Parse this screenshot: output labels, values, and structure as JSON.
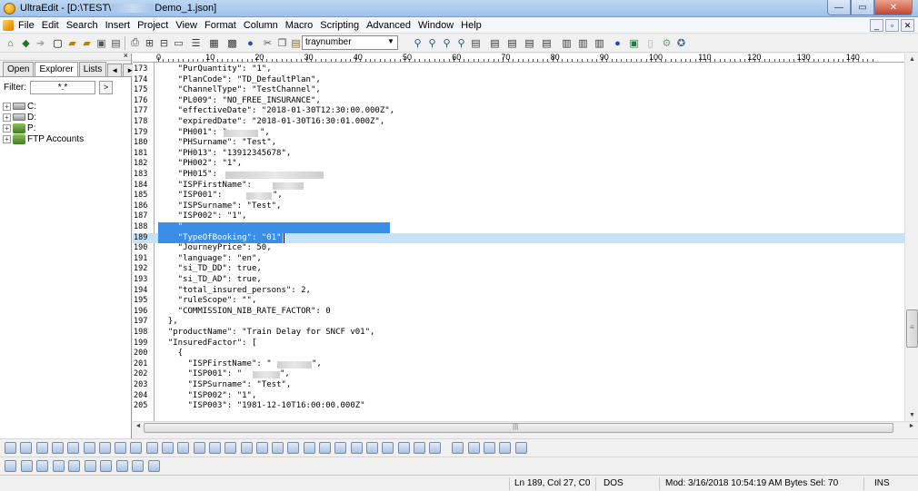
{
  "window": {
    "title_prefix": "UltraEdit - [D:\\TEST\\",
    "title_suffix": "Demo_1.json]",
    "buttons": {
      "minimize": "—",
      "maximize": "▭",
      "close": "✕"
    }
  },
  "menu": {
    "items": [
      "File",
      "Edit",
      "Search",
      "Insert",
      "Project",
      "View",
      "Format",
      "Column",
      "Macro",
      "Scripting",
      "Advanced",
      "Window",
      "Help"
    ],
    "mdi": [
      "_",
      "▫",
      "✕"
    ]
  },
  "toolbar": {
    "search_combo_value": "traynumber"
  },
  "left_panel": {
    "close": "×",
    "tabs": [
      "Open",
      "Explorer",
      "Lists"
    ],
    "active_tab": "Explorer",
    "nav_left": "◄",
    "nav_right": "►",
    "filter_label": "Filter:",
    "filter_value": "*.*",
    "filter_button": ">",
    "tree": [
      {
        "label": "C:",
        "kind": "drive"
      },
      {
        "label": "D:",
        "kind": "drive"
      },
      {
        "label": "P:",
        "kind": "net"
      },
      {
        "label": "FTP Accounts",
        "kind": "ftp"
      }
    ]
  },
  "editor": {
    "ruler_labels": [
      "0",
      "10",
      "20",
      "30",
      "40",
      "50",
      "60",
      "70",
      "80",
      "90",
      "100",
      "110",
      "120",
      "130",
      "140"
    ],
    "current_line": 189,
    "lines": [
      {
        "n": "173",
        "t": "    \"PurQuantity\": \"1\","
      },
      {
        "n": "174",
        "t": "    \"PlanCode\": \"TD_DefaultPlan\","
      },
      {
        "n": "175",
        "t": "    \"ChannelType\": \"TestChannel\","
      },
      {
        "n": "176",
        "t": "    \"PL009\": \"NO_FREE_INSURANCE\","
      },
      {
        "n": "177",
        "t": "    \"effectiveDate\": \"2018-01-30T12:30:00.000Z\","
      },
      {
        "n": "178",
        "t": "    \"expiredDate\": \"2018-01-30T16:30:01.000Z\","
      },
      {
        "n": "179",
        "t": "    \"PH001\": \""
      },
      {
        "n": "180",
        "t": "    \"PHSurname\": \"Test\","
      },
      {
        "n": "181",
        "t": "    \"PH013\": \"13912345678\","
      },
      {
        "n": "182",
        "t": "    \"PH002\": \"1\","
      },
      {
        "n": "183",
        "t": "    \"PH015\": "
      },
      {
        "n": "184",
        "t": "    \"ISPFirstName\": "
      },
      {
        "n": "185",
        "t": "    \"ISP001\": "
      },
      {
        "n": "186",
        "t": "    \"ISPSurname\": \"Test\","
      },
      {
        "n": "187",
        "t": "    \"ISP002\": \"1\","
      },
      {
        "n": "188",
        "t": "    \""
      },
      {
        "n": "189",
        "t": "    \"TypeOfBooking\": \"01\","
      },
      {
        "n": "190",
        "t": "    \"JourneyPrice\": 50,"
      },
      {
        "n": "191",
        "t": "    \"language\": \"en\","
      },
      {
        "n": "192",
        "t": "    \"si_TD_DD\": true,"
      },
      {
        "n": "193",
        "t": "    \"si_TD_AD\": true,"
      },
      {
        "n": "194",
        "t": "    \"total_insured_persons\": 2,"
      },
      {
        "n": "195",
        "t": "    \"ruleScope\": \"\","
      },
      {
        "n": "196",
        "t": "    \"COMMISSION_NIB_RATE_FACTOR\": 0"
      },
      {
        "n": "197",
        "t": "  },"
      },
      {
        "n": "198",
        "t": "  \"productName\": \"Train Delay for SNCF v01\","
      },
      {
        "n": "199",
        "t": "  \"InsuredFactor\": ["
      },
      {
        "n": "200",
        "t": "    {"
      },
      {
        "n": "201",
        "t": "      \"ISPFirstName\": \""
      },
      {
        "n": "202",
        "t": "      \"ISP001\": \""
      },
      {
        "n": "203",
        "t": "      \"ISPSurname\": \"Test\","
      },
      {
        "n": "204",
        "t": "      \"ISP002\": \"1\","
      },
      {
        "n": "205",
        "t": "      \"ISP003\": \"1981-12-10T16:00:00.000Z\""
      }
    ]
  },
  "statusbar": {
    "position": "Ln 189, Col 27, C0",
    "line_ending": "DOS",
    "modified": "Mod: 3/16/2018 10:54:19 AM  Bytes Sel: 70",
    "mode": "INS"
  },
  "scroll": {
    "h_left": "◄",
    "h_right": "►",
    "h_grip": "|||",
    "v_up": "▲",
    "v_down": "▼",
    "v_grip": "≡"
  }
}
